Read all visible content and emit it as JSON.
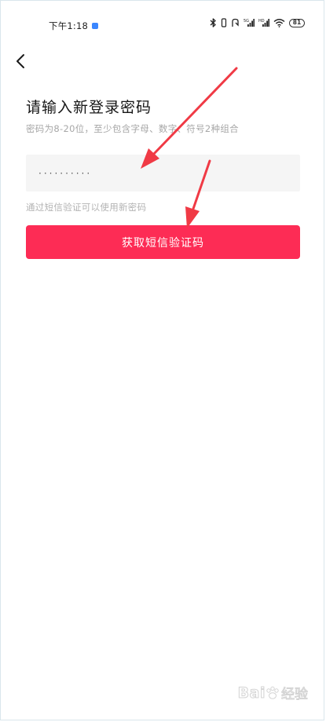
{
  "status_bar": {
    "time": "下午1:18",
    "battery": "81",
    "icons": [
      "bluetooth-icon",
      "vibrate-icon",
      "data-icon",
      "signal-icon",
      "signal-icon",
      "wifi-icon",
      "battery-icon"
    ]
  },
  "nav": {
    "back_icon": "chevron-left-icon"
  },
  "header": {
    "title": "请输入新登录密码",
    "subtitle": "密码为8-20位，至少包含字母、数字、符号2种组合"
  },
  "password_field": {
    "value": "··········"
  },
  "hint": {
    "text": "通过短信验证可以使用新密码"
  },
  "actions": {
    "get_code_label": "获取短信验证码"
  },
  "watermark": {
    "logo": "Bai",
    "sub": "经验"
  },
  "colors": {
    "accent": "#fd2c55",
    "arrow": "#f03a45",
    "input_bg": "#f5f5f5",
    "subtitle": "#a7a7a7"
  }
}
